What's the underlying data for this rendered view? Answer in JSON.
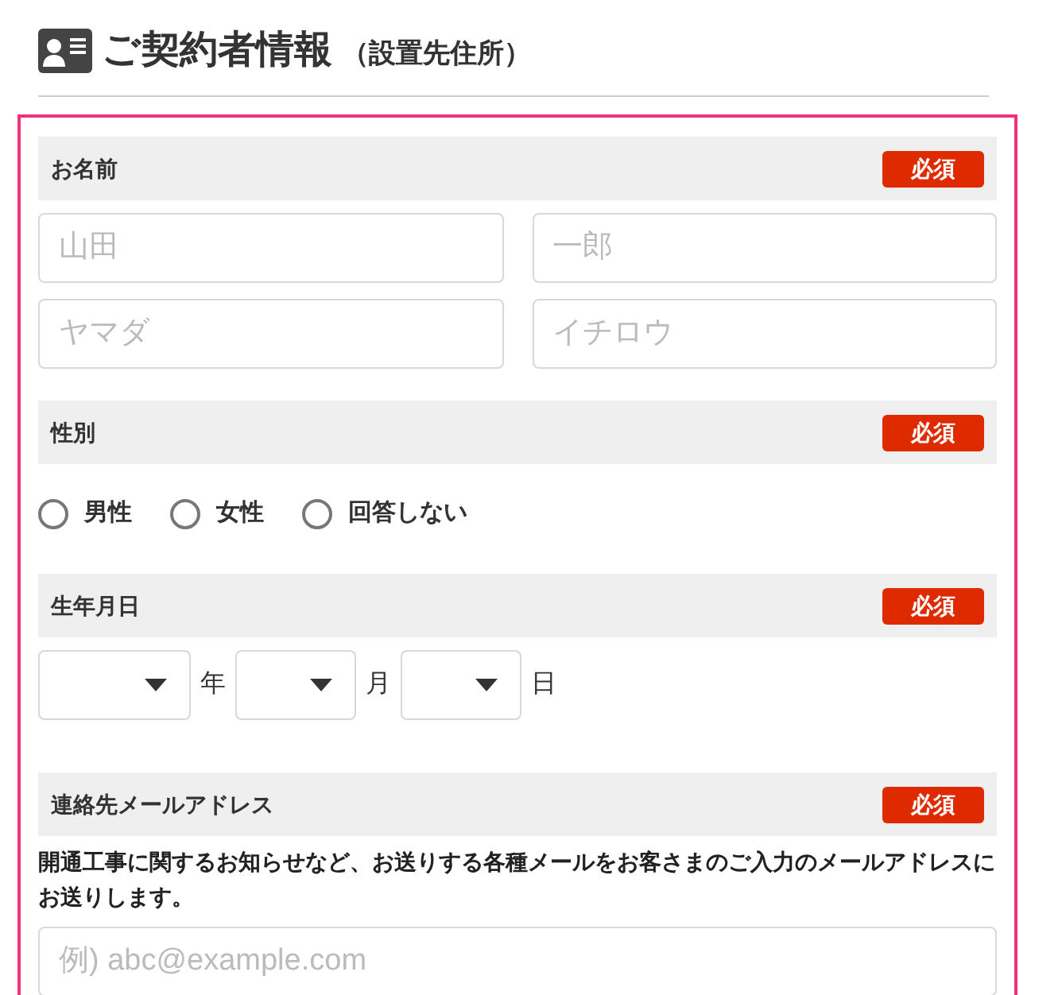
{
  "heading": {
    "title": "ご契約者情報",
    "subtitle": "（設置先住所）"
  },
  "sections": [
    {
      "kind": "name",
      "label": "お名前",
      "badge": "必須",
      "fields": [
        {
          "placeholder": "山田"
        },
        {
          "placeholder": "一郎"
        },
        {
          "placeholder": "ヤマダ"
        },
        {
          "placeholder": "イチロウ"
        }
      ]
    },
    {
      "kind": "radios",
      "label": "性別",
      "badge": "必須",
      "options": [
        {
          "label": "男性",
          "selected": false
        },
        {
          "label": "女性",
          "selected": false
        },
        {
          "label": "回答しない",
          "selected": false
        }
      ]
    },
    {
      "kind": "date",
      "label": "生年月日",
      "badge": "必須",
      "selects": [
        {
          "unit": "年"
        },
        {
          "unit": "月"
        },
        {
          "unit": "日"
        }
      ]
    },
    {
      "kind": "email",
      "label": "連絡先メールアドレス",
      "badge": "必須",
      "note": "開通工事に関するお知らせなど、お送りする各種メールをお客さまのご入力のメールアドレスにお送りします。",
      "placeholder": "例) abc@example.com"
    }
  ]
}
